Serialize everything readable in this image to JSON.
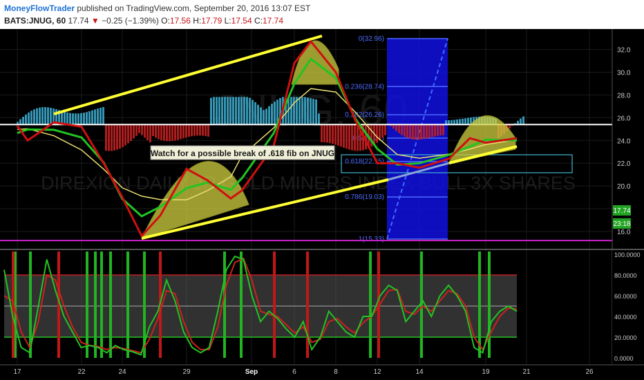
{
  "header": {
    "author": "MoneyFlowTrader",
    "published_text": "published on TradingView.com, September 20, 2016 13:07 EST",
    "symbol": "BATS:JNUG, 60",
    "last": "17.74",
    "change": "−0.25 (−1.39%)",
    "o_label": "O:",
    "o": "17.56",
    "h_label": "H:",
    "h": "17.79",
    "l_label": "L:",
    "l": "17.54",
    "c_label": "C:",
    "c": "17.74"
  },
  "watermark": {
    "ticker": "JNUG, 60",
    "name": "DIREXION DAILY JR GOLD MINERS INDEX BULL 3X SHARES"
  },
  "price_badges": {
    "last": "17.74",
    "countdown": "23:18"
  },
  "annotation": "Watch for a possible break of .618 fib on JNUG",
  "colors": {
    "background": "#000000",
    "price": "#d01010",
    "ma_fast": "#22c422",
    "ma_slow": "#e8e070",
    "trendline": "#ffff33",
    "horizontal": "#ffffff",
    "support": "#d020d0",
    "fib_zone": "#1010e0",
    "histogram_pos": "#3aa6c8",
    "histogram_neg": "#c02020",
    "stoch_k": "#22c422",
    "stoch_d": "#d02020"
  },
  "chart_data": [
    {
      "type": "line",
      "name": "price",
      "xaxis_labels": [
        "17",
        "22",
        "24",
        "29",
        "Sep",
        "6",
        "8",
        "12",
        "14",
        "19",
        "21",
        "26"
      ],
      "yaxis_ticks": [
        16,
        18,
        20,
        22,
        24,
        26,
        28,
        30,
        32
      ],
      "ylim": [
        14.6,
        33.8
      ],
      "price_series": [
        [
          "Aug 17",
          25.3
        ],
        [
          "Aug 18",
          24.0
        ],
        [
          "Aug 19",
          25.6
        ],
        [
          "Aug 22",
          25.2
        ],
        [
          "Aug 23",
          22.0
        ],
        [
          "Aug 24",
          19.0
        ],
        [
          "Aug 25",
          15.6
        ],
        [
          "Aug 26",
          17.4
        ],
        [
          "Aug 29",
          21.5
        ],
        [
          "Aug 30",
          20.5
        ],
        [
          "Aug 31",
          18.9
        ],
        [
          "Sep 1",
          19.6
        ],
        [
          "Sep 2",
          23.5
        ],
        [
          "Sep 6",
          30.8
        ],
        [
          "Sep 7",
          32.7
        ],
        [
          "Sep 8",
          30.0
        ],
        [
          "Sep 9",
          25.8
        ],
        [
          "Sep 12",
          22.0
        ],
        [
          "Sep 13",
          22.0
        ],
        [
          "Sep 14",
          21.6
        ],
        [
          "Sep 15",
          22.4
        ],
        [
          "Sep 16",
          24.2
        ],
        [
          "Sep 19",
          23.8
        ],
        [
          "Sep 20",
          24.2
        ]
      ],
      "fib_levels": [
        {
          "label": "0(32.96)",
          "value": 32.96
        },
        {
          "label": "0.236(28.74)",
          "value": 28.74
        },
        {
          "label": "0.382(26.26)",
          "value": 26.26
        },
        {
          "label": "0.5(24.21)",
          "value": 24.21
        },
        {
          "label": "0.618(22.15)",
          "value": 22.15
        },
        {
          "label": "0.786(19.03)",
          "value": 19.03
        },
        {
          "label": "1(15.33)",
          "value": 15.33
        }
      ],
      "horizontal_line": 25.4,
      "support_line": 15.2,
      "price_badge": 17.74
    },
    {
      "type": "line",
      "name": "stochastic",
      "yaxis_labels": [
        "100.0000",
        "80.0000",
        "60.0000",
        "40.0000",
        "20.0000",
        "0.0000"
      ],
      "ylim": [
        0,
        100
      ],
      "band": [
        20,
        80
      ],
      "midline": 50,
      "k_series": [
        85,
        40,
        10,
        5,
        50,
        95,
        65,
        40,
        25,
        10,
        12,
        10,
        5,
        12,
        8,
        6,
        3,
        30,
        45,
        75,
        55,
        25,
        10,
        5,
        10,
        45,
        85,
        98,
        95,
        60,
        35,
        45,
        38,
        28,
        20,
        35,
        8,
        20,
        45,
        35,
        25,
        20,
        40,
        40,
        60,
        70,
        65,
        35,
        45,
        55,
        40,
        60,
        70,
        60,
        45,
        10,
        5,
        35,
        45,
        50,
        45
      ],
      "d_series": [
        60,
        55,
        25,
        10,
        35,
        80,
        75,
        50,
        30,
        15,
        12,
        11,
        8,
        10,
        9,
        7,
        5,
        18,
        38,
        65,
        62,
        35,
        15,
        8,
        8,
        30,
        70,
        92,
        96,
        75,
        45,
        42,
        40,
        32,
        24,
        30,
        15,
        18,
        35,
        38,
        30,
        24,
        34,
        40,
        52,
        65,
        66,
        45,
        42,
        50,
        45,
        55,
        65,
        62,
        50,
        20,
        8,
        25,
        40,
        48,
        47
      ]
    }
  ]
}
